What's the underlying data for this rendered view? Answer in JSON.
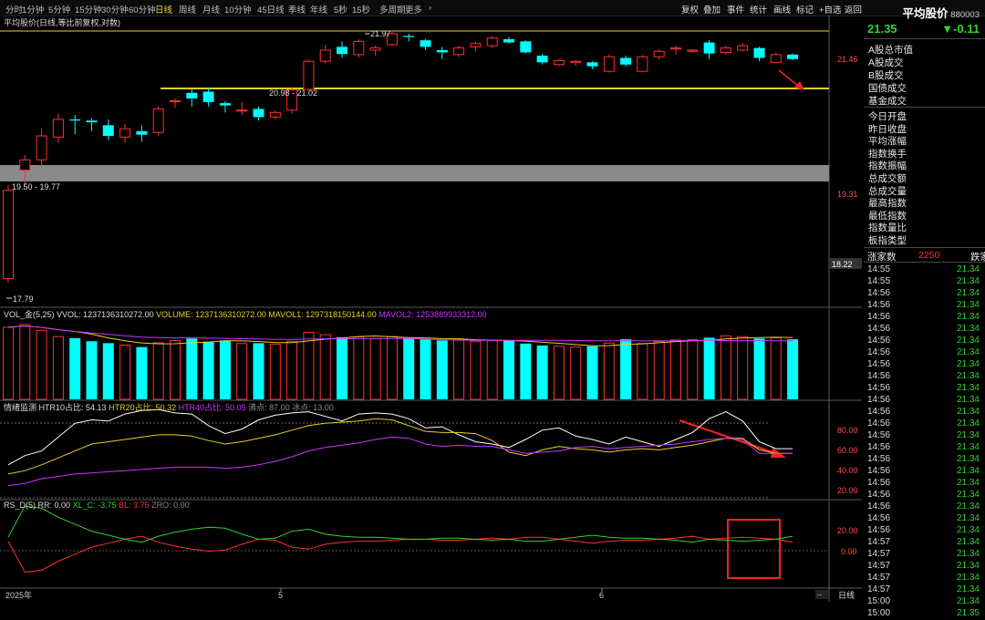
{
  "topbar": {
    "tabs": [
      "分时",
      "1分钟",
      "5分钟",
      "15分钟",
      "30分钟",
      "60分钟",
      "日线",
      "周线",
      "月线",
      "10分钟",
      "45日线",
      "季线",
      "年线",
      "5秒",
      "15秒",
      "多周期",
      "更多"
    ],
    "active_tab": "日线",
    "more_arrow": "›",
    "right_tools": [
      "复权",
      "叠加",
      "事件",
      "统计",
      "画线",
      "标记",
      "+自选",
      "返回"
    ]
  },
  "main": {
    "title": "平均股价(日线,等比前复权,对数)",
    "price_labels": {
      "high": "21.97",
      "low": "17.79",
      "zone_low": "19.50 - 19.77",
      "zone_mid": "20.98 - 21.02"
    },
    "y_axis": [
      "21.46",
      "19.31",
      "18.22"
    ],
    "x_axis": [
      "2025年",
      "5",
      "6"
    ],
    "period_btn": "日线",
    "scroll_btn": "--"
  },
  "vol": {
    "name": "VOL_金(5,25)",
    "vvol": "VVOL: 1237136310272.00",
    "volume": "VOLUME: 1237136310272.00",
    "ma1": "MAVOL1: 1297318150144.00",
    "ma2": "MAVOL2: 1253889933312.00"
  },
  "emo": {
    "name": "情绪监测",
    "htr10": "HTR10占比: 54.13",
    "htr20": "HTR20占比: 50.32",
    "htr40": "HTR40占比: 50.05",
    "hot": "沸点: 87.00",
    "cold": "冰点: 13.00",
    "y_axis": [
      "80.00",
      "60.00",
      "40.00",
      "20.00"
    ]
  },
  "rsd": {
    "name": "RS_D(5)",
    "rr": "RR: 0.00",
    "xlc": "XL_C: -3.75",
    "bl": "BL: 3.75",
    "zro": "ZRO: 0.00",
    "y_axis": [
      "20.00",
      "0.00"
    ]
  },
  "side": {
    "title": "平均股价",
    "code": "880003",
    "price": "21.35",
    "change": "▼-0.11",
    "menu_group1": [
      "A股总市值",
      "A股成交",
      "B股成交",
      "国债成交",
      "基金成交"
    ],
    "menu_group2": [
      "今日开盘",
      "昨日收盘",
      "平均涨幅",
      "指数换手",
      "指数振幅",
      "总成交额",
      "总成交量",
      "最高指数",
      "最低指数",
      "指数量比",
      "板指类型"
    ],
    "updown_label": "涨家数",
    "updown_value": "2250",
    "updown_label2": "跌家",
    "ticks": [
      {
        "t": "14:55",
        "p": "21.34"
      },
      {
        "t": "14:55",
        "p": "21.34"
      },
      {
        "t": "14:56",
        "p": "21.34"
      },
      {
        "t": "14:56",
        "p": "21.34"
      },
      {
        "t": "14:56",
        "p": "21.34"
      },
      {
        "t": "14:56",
        "p": "21.34"
      },
      {
        "t": "14:56",
        "p": "21.34"
      },
      {
        "t": "14:56",
        "p": "21.34"
      },
      {
        "t": "14:56",
        "p": "21.34"
      },
      {
        "t": "14:56",
        "p": "21.34"
      },
      {
        "t": "14:56",
        "p": "21.34"
      },
      {
        "t": "14:56",
        "p": "21.34"
      },
      {
        "t": "14:56",
        "p": "21.34"
      },
      {
        "t": "14:56",
        "p": "21.34"
      },
      {
        "t": "14:56",
        "p": "21.34"
      },
      {
        "t": "14:56",
        "p": "21.34"
      },
      {
        "t": "14:56",
        "p": "21.34"
      },
      {
        "t": "14:56",
        "p": "21.34"
      },
      {
        "t": "14:56",
        "p": "21.34"
      },
      {
        "t": "14:56",
        "p": "21.34"
      },
      {
        "t": "14:56",
        "p": "21.34"
      },
      {
        "t": "14:56",
        "p": "21.34"
      },
      {
        "t": "14:56",
        "p": "21.34"
      },
      {
        "t": "14:57",
        "p": "21.34"
      },
      {
        "t": "14:57",
        "p": "21.34"
      },
      {
        "t": "14:57",
        "p": "21.34"
      },
      {
        "t": "14:57",
        "p": "21.34"
      },
      {
        "t": "14:57",
        "p": "21.34"
      },
      {
        "t": "15:00",
        "p": "21.34"
      },
      {
        "t": "15:00",
        "p": "21.35"
      }
    ]
  },
  "colors": {
    "up": "#ff3030",
    "down": "#00ffff",
    "yellow": "#e8d020",
    "white": "#ffffff",
    "magenta": "#cc33ff",
    "green": "#2fd42f",
    "grid": "#333333"
  },
  "chart_data": {
    "type": "candlestick",
    "title": "平均股价",
    "ohlc": [
      [
        17.85,
        19.31,
        17.79,
        19.22
      ],
      [
        19.55,
        19.8,
        19.3,
        19.72
      ],
      [
        19.72,
        20.25,
        19.6,
        20.12
      ],
      [
        20.1,
        20.5,
        20.0,
        20.4
      ],
      [
        20.4,
        20.48,
        20.15,
        20.38
      ],
      [
        20.38,
        20.42,
        20.2,
        20.35
      ],
      [
        20.3,
        20.4,
        20.05,
        20.12
      ],
      [
        20.1,
        20.32,
        20.0,
        20.24
      ],
      [
        20.2,
        20.3,
        20.02,
        20.14
      ],
      [
        20.18,
        20.62,
        20.12,
        20.58
      ],
      [
        20.72,
        20.76,
        20.6,
        20.72
      ],
      [
        20.86,
        20.92,
        20.62,
        20.76
      ],
      [
        20.88,
        20.95,
        20.62,
        20.7
      ],
      [
        20.68,
        20.72,
        20.52,
        20.64
      ],
      [
        20.55,
        20.7,
        20.48,
        20.56
      ],
      [
        20.58,
        20.62,
        20.38,
        20.44
      ],
      [
        20.44,
        20.55,
        20.4,
        20.52
      ],
      [
        20.56,
        20.96,
        20.5,
        20.91
      ],
      [
        20.92,
        21.45,
        20.9,
        21.42
      ],
      [
        21.42,
        21.72,
        21.38,
        21.62
      ],
      [
        21.68,
        21.78,
        21.48,
        21.55
      ],
      [
        21.54,
        21.82,
        21.48,
        21.78
      ],
      [
        21.62,
        21.7,
        21.52,
        21.66
      ],
      [
        21.72,
        21.97,
        21.7,
        21.92
      ],
      [
        21.88,
        21.92,
        21.78,
        21.86
      ],
      [
        21.8,
        21.82,
        21.62,
        21.68
      ],
      [
        21.62,
        21.68,
        21.46,
        21.58
      ],
      [
        21.54,
        21.7,
        21.5,
        21.66
      ],
      [
        21.68,
        21.78,
        21.6,
        21.74
      ],
      [
        21.7,
        21.88,
        21.66,
        21.84
      ],
      [
        21.82,
        21.86,
        21.74,
        21.76
      ],
      [
        21.78,
        21.8,
        21.56,
        21.58
      ],
      [
        21.52,
        21.55,
        21.36,
        21.4
      ],
      [
        21.36,
        21.46,
        21.33,
        21.43
      ],
      [
        21.4,
        21.44,
        21.34,
        21.42
      ],
      [
        21.4,
        21.42,
        21.28,
        21.33
      ],
      [
        21.24,
        21.54,
        21.22,
        21.5
      ],
      [
        21.48,
        21.52,
        21.32,
        21.36
      ],
      [
        21.24,
        21.53,
        21.22,
        21.5
      ],
      [
        21.5,
        21.64,
        21.45,
        21.6
      ],
      [
        21.64,
        21.7,
        21.54,
        21.66
      ],
      [
        21.6,
        21.64,
        21.58,
        21.62
      ],
      [
        21.76,
        21.8,
        21.46,
        21.56
      ],
      [
        21.58,
        21.7,
        21.54,
        21.66
      ],
      [
        21.62,
        21.75,
        21.6,
        21.7
      ],
      [
        21.66,
        21.68,
        21.42,
        21.48
      ],
      [
        21.4,
        21.58,
        21.38,
        21.54
      ],
      [
        21.54,
        21.56,
        21.44,
        21.46
      ]
    ],
    "volume": [
      1.86,
      1.93,
      1.78,
      1.62,
      1.58,
      1.5,
      1.45,
      1.4,
      1.35,
      1.46,
      1.52,
      1.57,
      1.49,
      1.52,
      1.44,
      1.45,
      1.42,
      1.5,
      1.73,
      1.67,
      1.6,
      1.61,
      1.57,
      1.62,
      1.58,
      1.55,
      1.52,
      1.54,
      1.5,
      1.52,
      1.52,
      1.44,
      1.39,
      1.37,
      1.35,
      1.37,
      1.45,
      1.55,
      1.44,
      1.49,
      1.53,
      1.54,
      1.59,
      1.64,
      1.62,
      1.57,
      1.59,
      1.55
    ],
    "vol_ylim": [
      0,
      2.0
    ],
    "htr10": [
      40,
      48,
      52,
      64,
      76,
      79,
      78,
      84,
      87,
      88,
      85,
      84,
      74,
      67,
      71,
      79,
      83,
      85,
      86,
      82,
      78,
      84,
      85,
      84,
      80,
      72,
      73,
      66,
      60,
      58,
      55,
      62,
      70,
      72,
      65,
      62,
      58,
      64,
      60,
      56,
      62,
      68,
      80,
      86,
      78,
      60,
      54,
      54
    ],
    "htr20": [
      32,
      35,
      40,
      46,
      52,
      58,
      60,
      62,
      64,
      66,
      66,
      65,
      61,
      58,
      60,
      63,
      66,
      70,
      74,
      76,
      77,
      78,
      80,
      79,
      74,
      69,
      68,
      68,
      67,
      61,
      51,
      48,
      53,
      56,
      54,
      53,
      51,
      53,
      54,
      53,
      55,
      57,
      60,
      63,
      63,
      53,
      50,
      50
    ],
    "htr40": [
      22,
      24,
      28,
      30,
      32,
      33,
      34,
      35,
      36,
      37,
      38,
      38,
      38,
      37,
      38,
      40,
      43,
      47,
      52,
      55,
      57,
      59,
      62,
      64,
      63,
      58,
      56,
      57,
      56,
      56,
      53,
      50,
      51,
      52,
      55,
      56,
      54,
      55,
      56,
      57,
      58,
      60,
      62,
      63,
      62,
      50,
      50,
      50
    ],
    "emo_ylim": [
      13,
      92
    ],
    "rs_red": [
      -2,
      -33,
      -31,
      -22,
      -15,
      -8,
      -4,
      0,
      3,
      -3,
      -7,
      -10,
      -12,
      -11,
      -5,
      0,
      -1,
      -8,
      -10,
      -5,
      -3,
      -2,
      -2,
      -1,
      0,
      0,
      -1,
      -1,
      0,
      1,
      0,
      2,
      2,
      0,
      -2,
      -4,
      -2,
      -1,
      -1,
      0,
      1,
      3,
      0,
      1,
      2,
      1,
      0,
      -3
    ],
    "rs_green": [
      2,
      33,
      31,
      22,
      15,
      8,
      4,
      0,
      -3,
      3,
      7,
      10,
      12,
      11,
      5,
      0,
      1,
      8,
      10,
      5,
      3,
      2,
      2,
      1,
      0,
      0,
      1,
      1,
      0,
      -1,
      0,
      -2,
      -2,
      0,
      2,
      4,
      2,
      1,
      1,
      0,
      -1,
      -3,
      0,
      -1,
      -2,
      -1,
      0,
      3
    ],
    "rs_ylim": [
      -48,
      35
    ]
  }
}
